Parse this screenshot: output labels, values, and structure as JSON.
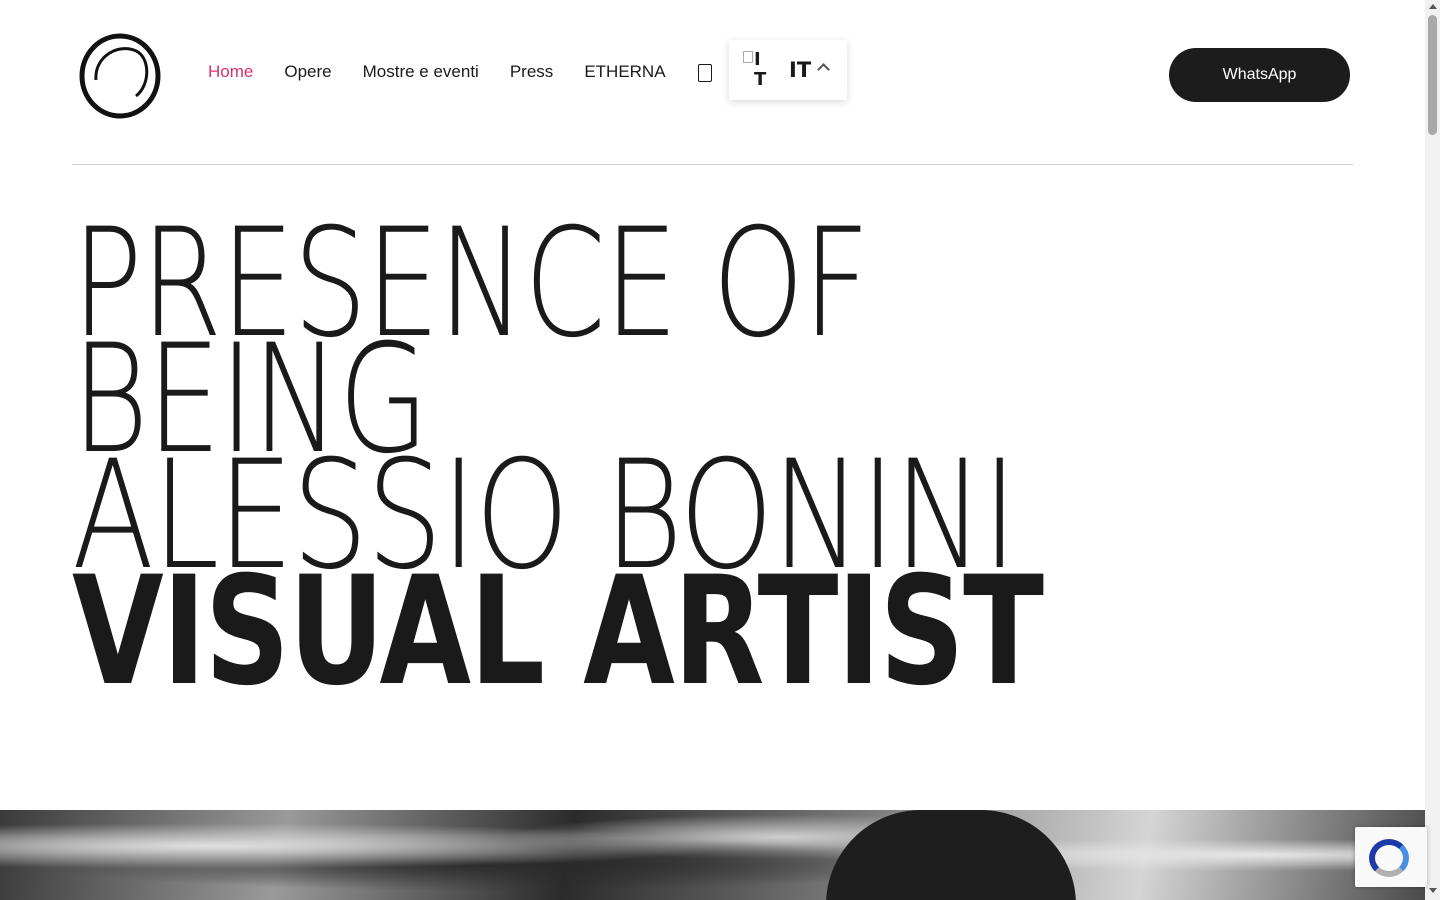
{
  "nav": {
    "items": [
      {
        "label": "Home",
        "active": true
      },
      {
        "label": "Opere"
      },
      {
        "label": "Mostre e eventi"
      },
      {
        "label": "Press"
      },
      {
        "label": "ETHERNA"
      }
    ],
    "search_icon": "search-icon"
  },
  "language": {
    "flag_alt": "IT",
    "code": "IT"
  },
  "whatsapp": {
    "label": "WhatsApp"
  },
  "hero": {
    "line1": "PRESENCE OF",
    "line2": "BEING",
    "line3": "ALESSIO BONINI",
    "line4": "VISUAL ARTIST"
  },
  "colors": {
    "accent": "#d6336c",
    "dark": "#1c1c1c"
  }
}
